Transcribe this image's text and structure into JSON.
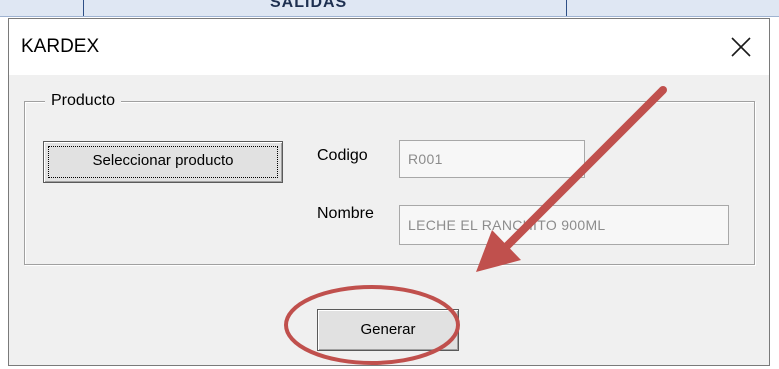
{
  "background_sheet": {
    "header_text": "SALIDAS"
  },
  "dialog": {
    "title": "KARDEX",
    "close_icon": "close-icon"
  },
  "group": {
    "legend": "Producto"
  },
  "buttons": {
    "select_product": "Seleccionar producto",
    "generate": "Generar"
  },
  "fields": {
    "codigo_label": "Codigo",
    "codigo_value": "R001",
    "nombre_label": "Nombre",
    "nombre_value": "LECHE EL RANCHITO 900ML"
  },
  "annotation": {
    "color": "#c0504d",
    "shapes": [
      "arrow",
      "ellipse"
    ]
  },
  "colors": {
    "dialog_bg": "#f0f0f0",
    "titlebar_bg": "#ffffff",
    "field_text": "#8c8c8c"
  }
}
